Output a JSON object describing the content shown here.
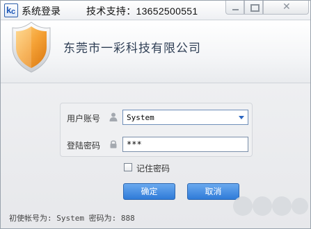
{
  "window": {
    "title": "系统登录",
    "support": "技术支持：13652500551"
  },
  "header": {
    "company": "东莞市一彩科技有限公司"
  },
  "form": {
    "username_label": "用户账号",
    "username_value": "System",
    "password_label": "登陆密码",
    "password_value": "***",
    "remember_label": "记住密码",
    "remember_checked": false
  },
  "buttons": {
    "ok": "确定",
    "cancel": "取消"
  },
  "footer": {
    "hint": "初使帐号为: System 密码为: 888"
  },
  "icons": {
    "app": "app-logo-icon",
    "shield": "shield-icon",
    "user": "user-icon",
    "lock": "lock-icon"
  },
  "colors": {
    "accent": "#2f7bd8",
    "shield": "#f09a2a",
    "company_text": "#2f3f55"
  }
}
